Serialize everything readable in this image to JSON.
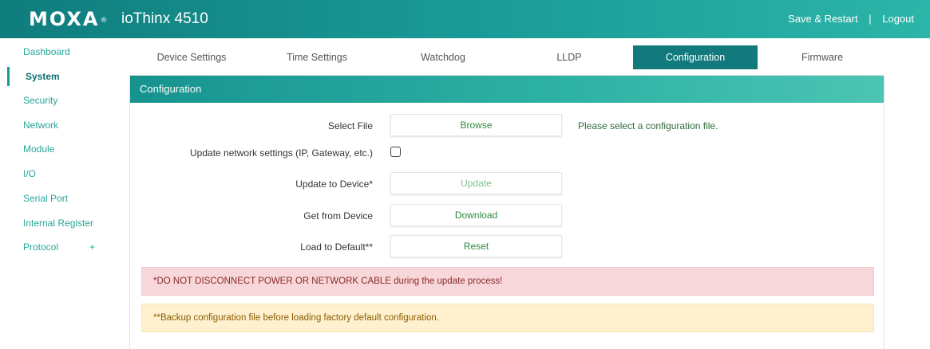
{
  "header": {
    "brand": "MOXA",
    "brand_mark": "®",
    "product": "ioThinx 4510",
    "save_restart": "Save & Restart",
    "separator": "|",
    "logout": "Logout"
  },
  "sidebar": {
    "items": [
      {
        "label": "Dashboard"
      },
      {
        "label": "System",
        "active": true
      },
      {
        "label": "Security"
      },
      {
        "label": "Network"
      },
      {
        "label": "Module"
      },
      {
        "label": "I/O"
      },
      {
        "label": "Serial Port"
      },
      {
        "label": "Internal Register"
      },
      {
        "label": "Protocol",
        "expand": "+"
      }
    ]
  },
  "tabs": [
    {
      "label": "Device Settings"
    },
    {
      "label": "Time Settings"
    },
    {
      "label": "Watchdog"
    },
    {
      "label": "LLDP"
    },
    {
      "label": "Configuration",
      "active": true
    },
    {
      "label": "Firmware"
    }
  ],
  "panel": {
    "title": "Configuration",
    "select_file": {
      "label": "Select File",
      "button": "Browse",
      "hint": "Please select a configuration file."
    },
    "update_network": {
      "label": "Update network settings (IP, Gateway, etc.)",
      "checked": false
    },
    "update_device": {
      "label": "Update to Device*",
      "button": "Update"
    },
    "get_device": {
      "label": "Get from Device",
      "button": "Download"
    },
    "load_default": {
      "label": "Load to Default**",
      "button": "Reset"
    },
    "alert_danger": "*DO NOT DISCONNECT POWER OR NETWORK CABLE during the update process!",
    "alert_warning": "**Backup configuration file before loading factory default configuration."
  },
  "colors": {
    "header_start": "#0f7d7d",
    "header_end": "#2cb5a9",
    "accent": "#127a7c",
    "sidebar_text": "#2aa69b",
    "button_text": "#2e8b3e",
    "danger_bg": "#f8d7da",
    "warning_bg": "#fff1cf"
  }
}
